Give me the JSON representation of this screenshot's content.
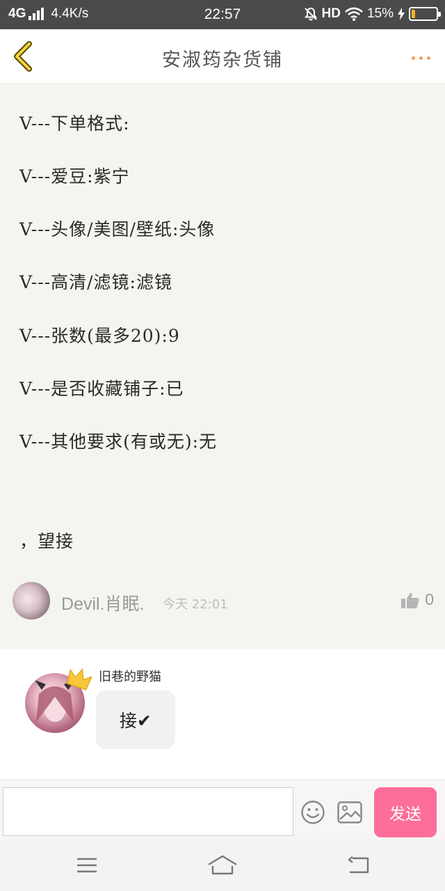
{
  "status_bar": {
    "network": "4G",
    "speed": "4.4K/s",
    "time": "22:57",
    "hd": "HD",
    "battery_text": "15%",
    "battery_level": 0.15
  },
  "header": {
    "title": "安淑筠杂货铺",
    "back_icon": "chevron-left-icon",
    "more_icon": "more-dots-icon",
    "accent_color": "#f0a060"
  },
  "post": {
    "lines": [
      "V---下单格式:",
      "V---爱豆:紫宁",
      "V---头像/美图/壁纸:头像",
      "V---高清/滤镜:滤镜",
      "V---张数(最多20):9",
      "V---是否收藏铺子:已",
      "V---其他要求(有或无):无",
      "，望接"
    ],
    "author": {
      "name": "Devil.肖眠.",
      "time": "今天 22:01",
      "likes": "0"
    }
  },
  "reply": {
    "name": "旧巷的野猫",
    "message": "接✔"
  },
  "input_bar": {
    "placeholder": "",
    "send_label": "发送",
    "send_color": "#fd6e9a"
  },
  "nav_bar": {
    "icons": [
      "menu-icon",
      "home-icon",
      "back-icon"
    ]
  }
}
